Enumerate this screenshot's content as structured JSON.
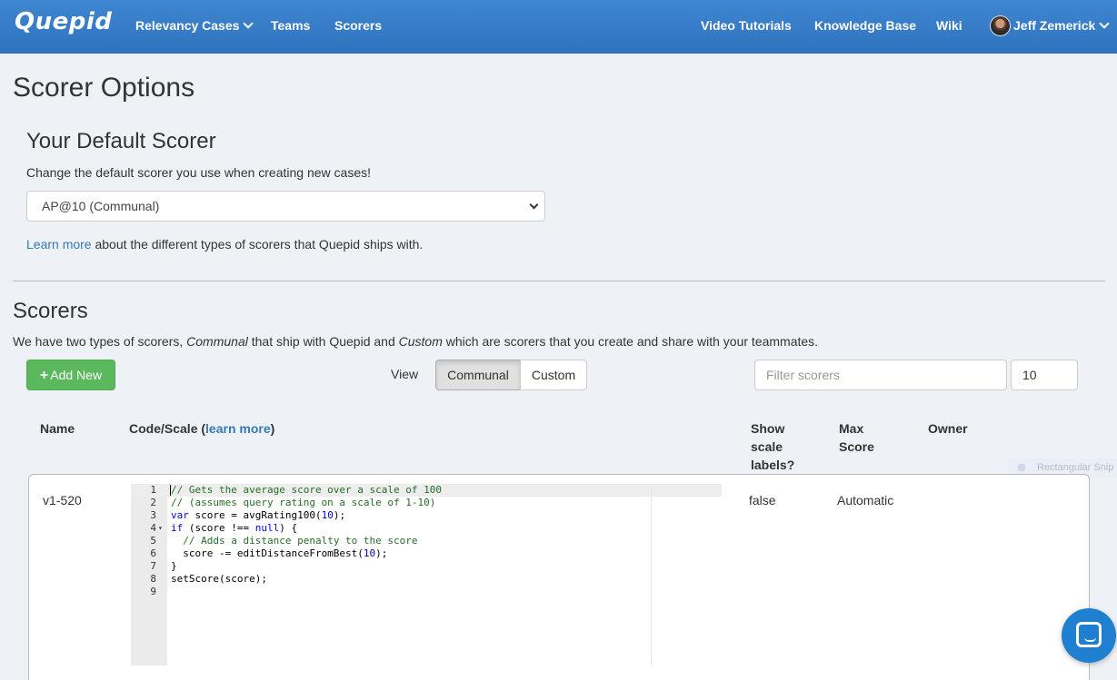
{
  "navbar": {
    "brand": "Quepid",
    "items": [
      "Relevancy Cases",
      "Teams",
      "Scorers"
    ],
    "right_items": [
      "Video Tutorials",
      "Knowledge Base",
      "Wiki"
    ],
    "user": "Jeff Zemerick"
  },
  "page": {
    "title": "Scorer Options"
  },
  "default_scorer": {
    "title": "Your Default Scorer",
    "description": "Change the default scorer you use when creating new cases!",
    "selected": "AP@10 (Communal)",
    "learn_more_link": "Learn more",
    "learn_more_rest": " about the different types of scorers that Quepid ships with."
  },
  "scorers": {
    "title": "Scorers",
    "intro_a": "We have two types of scorers, ",
    "intro_communal": "Communal",
    "intro_b": " that ship with Quepid and ",
    "intro_custom": "Custom",
    "intro_c": " which are scorers that you create and share with your teammates.",
    "add_new": "Add New",
    "view_label": "View",
    "view_options": [
      "Communal",
      "Custom"
    ],
    "filter_placeholder": "Filter scorers",
    "per_page": "10",
    "columns": {
      "name": "Name",
      "code_scale": "Code/Scale (",
      "learn_more": "learn more",
      "code_scale_end": ")",
      "show_scale_labels": [
        "Show",
        "scale",
        "labels?"
      ],
      "max_score": [
        "Max",
        "Score"
      ],
      "owner": "Owner"
    },
    "rows": [
      {
        "name": "v1-520",
        "show_scale_labels": "false",
        "max_score": "Automatic",
        "owner": "",
        "code": [
          "// Gets the average score over a scale of 100",
          "// (assumes query rating on a scale of 1-10)",
          "var score = avgRating100(10);",
          "if (score !== null) {",
          "  // Adds a distance penalty to the score",
          "  score -= editDistanceFromBest(10);",
          "}",
          "setScore(score);",
          ""
        ]
      }
    ]
  },
  "overlay": {
    "snip_label": "Rectangular Snip"
  },
  "icons": {
    "add": "plus-icon",
    "dropdown": "chevron-down-icon",
    "chat": "chat-launcher-icon"
  },
  "colors": {
    "navbar": "#2f73bf",
    "success": "#5cb85c",
    "link": "#337ab7",
    "chat": "#1f7fd1"
  }
}
